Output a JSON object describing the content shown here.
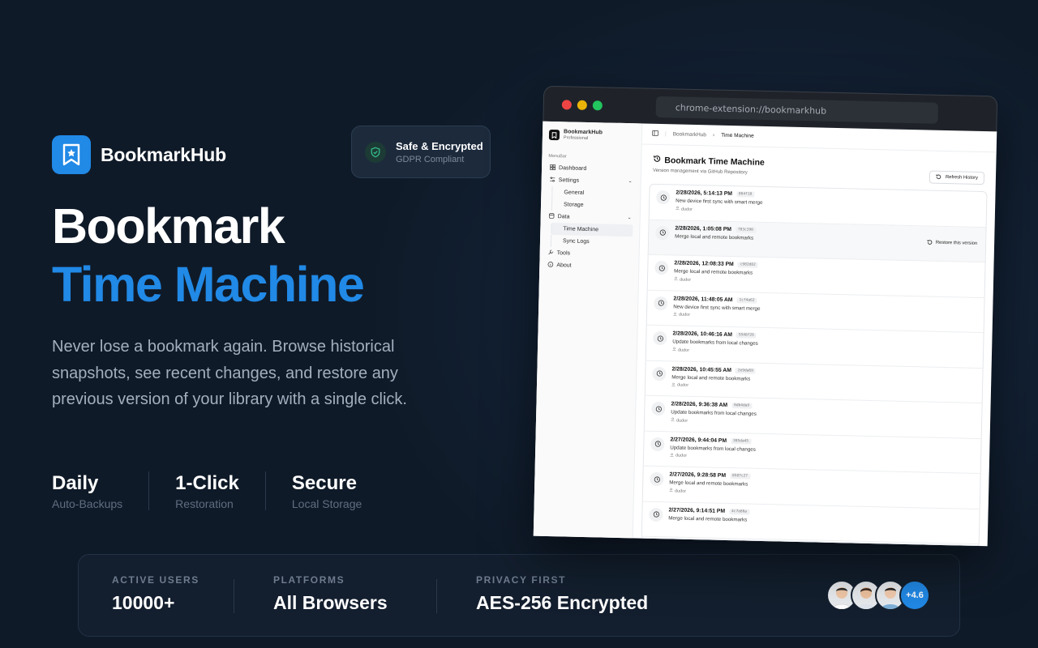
{
  "brand": {
    "name": "BookmarkHub"
  },
  "badge": {
    "title": "Safe & Encrypted",
    "subtitle": "GDPR Compliant"
  },
  "hero": {
    "line1": "Bookmark",
    "line2": "Time Machine",
    "description": "Never lose a bookmark again. Browse historical snapshots, see recent changes, and restore any previous version of your library with a single click."
  },
  "stats": [
    {
      "title": "Daily",
      "subtitle": "Auto-Backups"
    },
    {
      "title": "1-Click",
      "subtitle": "Restoration"
    },
    {
      "title": "Secure",
      "subtitle": "Local Storage"
    }
  ],
  "bottom": {
    "metrics": [
      {
        "label": "ACTIVE USERS",
        "value": "10000+"
      },
      {
        "label": "PLATFORMS",
        "value": "All Browsers"
      },
      {
        "label": "PRIVACY FIRST",
        "value": "AES-256 Encrypted"
      }
    ],
    "avatars_more": "+4.6"
  },
  "browser": {
    "url": "chrome-extension://bookmarkhub",
    "dot_colors": [
      "#ef4444",
      "#eab308",
      "#22c55e"
    ]
  },
  "app": {
    "brand": {
      "name": "BookmarkHub",
      "plan": "Professional"
    },
    "sidebar": {
      "section": "MenuBar",
      "items": [
        {
          "label": "Dashboard",
          "icon": "grid-icon"
        },
        {
          "label": "Settings",
          "icon": "sliders-icon",
          "children": [
            "General",
            "Storage"
          ]
        },
        {
          "label": "Data",
          "icon": "database-icon",
          "children": [
            "Time Machine",
            "Sync Logs"
          ]
        },
        {
          "label": "Tools",
          "icon": "wrench-icon"
        },
        {
          "label": "About",
          "icon": "info-icon"
        }
      ]
    },
    "breadcrumb": {
      "root": "BookmarkHub",
      "current": "Time Machine"
    },
    "page": {
      "title": "Bookmark Time Machine",
      "subtitle": "Version management via GitHub Repository",
      "refresh_label": "Refresh History",
      "restore_label": "Restore this version"
    },
    "history": [
      {
        "date": "2/28/2026, 5:14:13 PM",
        "hash": "864f18",
        "message": "New device first sync with smart merge",
        "user": "dudor"
      },
      {
        "date": "2/28/2026, 1:05:08 PM",
        "hash": "f83c390",
        "message": "Merge local and remote bookmarks",
        "user": ""
      },
      {
        "date": "2/28/2026, 12:08:33 PM",
        "hash": "c982d82",
        "message": "Merge local and remote bookmarks",
        "user": "dudor"
      },
      {
        "date": "2/28/2026, 11:48:05 AM",
        "hash": "1cf4a62",
        "message": "New device first sync with smart merge",
        "user": "dudor"
      },
      {
        "date": "2/28/2026, 10:46:16 AM",
        "hash": "5548f26",
        "message": "Update bookmarks from local changes",
        "user": "dudor"
      },
      {
        "date": "2/28/2026, 10:45:55 AM",
        "hash": "2e9da69",
        "message": "Merge local and remote bookmarks",
        "user": "dudor"
      },
      {
        "date": "2/28/2026, 9:36:38 AM",
        "hash": "6db4da9",
        "message": "Update bookmarks from local changes",
        "user": "dudor"
      },
      {
        "date": "2/27/2026, 9:44:04 PM",
        "hash": "385da45",
        "message": "Update bookmarks from local changes",
        "user": "dudor"
      },
      {
        "date": "2/27/2026, 9:28:58 PM",
        "hash": "8587c27",
        "message": "Merge local and remote bookmarks",
        "user": "dudor"
      },
      {
        "date": "2/27/2026, 9:14:51 PM",
        "hash": "4c7a86a",
        "message": "Merge local and remote bookmarks",
        "user": ""
      }
    ]
  }
}
